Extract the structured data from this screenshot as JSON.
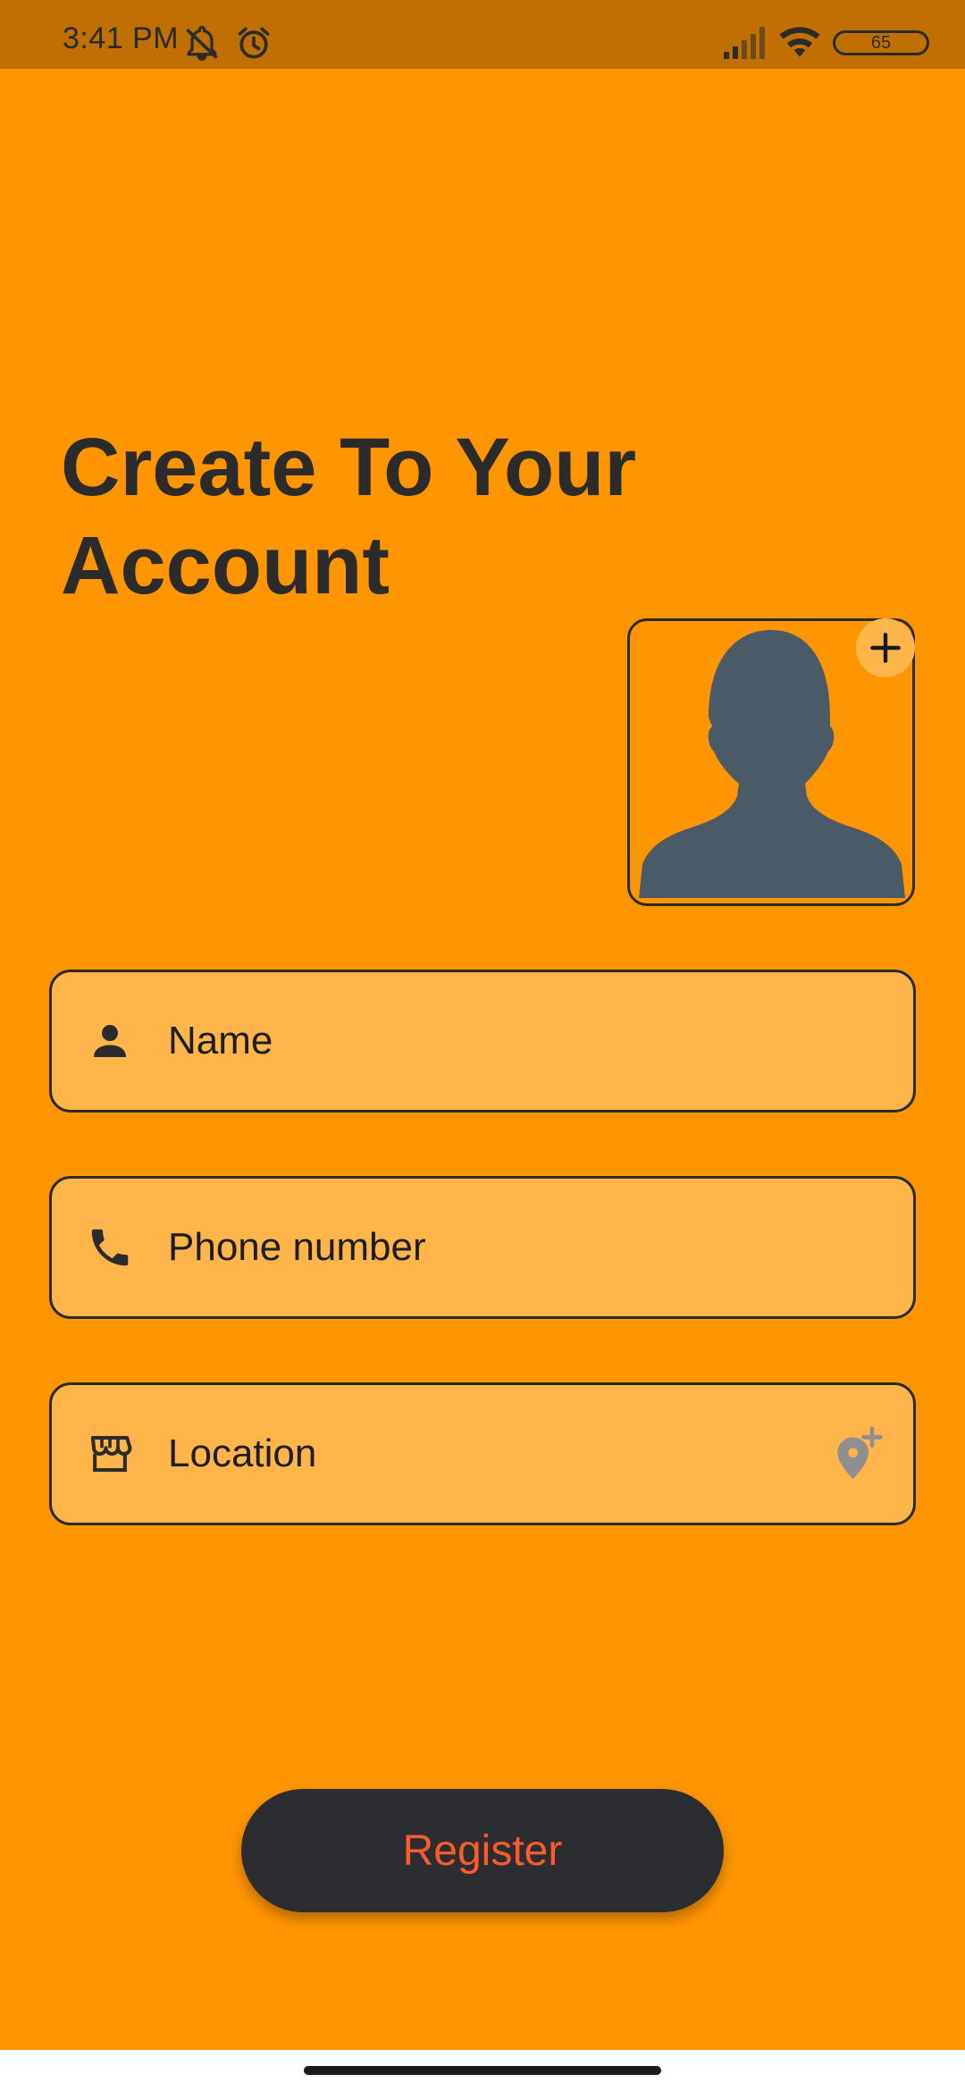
{
  "status_bar": {
    "time": "3:41 PM",
    "battery_level": "65",
    "icons": [
      "mute-notifications-icon",
      "alarm-icon",
      "signal-icon",
      "wifi-icon",
      "battery-icon"
    ]
  },
  "title": "Create To Your Account",
  "avatar": {
    "icon": "person-silhouette-icon",
    "add_icon": "plus-icon"
  },
  "form": {
    "name": {
      "placeholder": "Name",
      "icon": "person-icon",
      "value": ""
    },
    "phone": {
      "placeholder": "Phone number",
      "icon": "phone-icon",
      "value": ""
    },
    "location": {
      "placeholder": "Location",
      "icon": "store-icon",
      "action_icon": "add-location-icon",
      "value": ""
    }
  },
  "register_label": "Register",
  "colors": {
    "background": "#ff9500",
    "status_bar": "#bf7000",
    "field_fill": "#ffb54a",
    "text_dark": "#2b2b2b",
    "button_fill": "#2b2d31",
    "button_text": "#ff5a2b",
    "silhouette": "#4a5a66"
  }
}
